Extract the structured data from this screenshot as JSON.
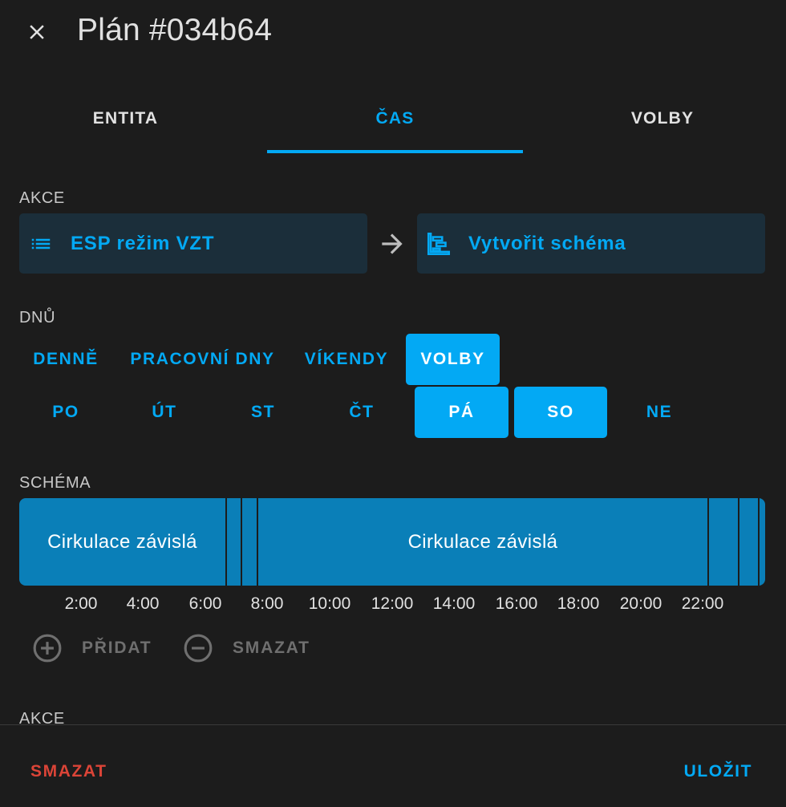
{
  "dialog": {
    "title": "Plán #034b64"
  },
  "tabs": [
    {
      "label": "ENTITA",
      "active": false
    },
    {
      "label": "ČAS",
      "active": true
    },
    {
      "label": "VOLBY",
      "active": false
    }
  ],
  "action_section": {
    "label": "AKCE",
    "entity_button": "ESP režim VZT",
    "schema_button": "Vytvořit schéma"
  },
  "days_section": {
    "label": "DNŮ",
    "presets": [
      {
        "label": "DENNĚ",
        "selected": false
      },
      {
        "label": "PRACOVNÍ DNY",
        "selected": false
      },
      {
        "label": "VÍKENDY",
        "selected": false
      },
      {
        "label": "VOLBY",
        "selected": true
      }
    ],
    "days": [
      {
        "label": "PO",
        "selected": false
      },
      {
        "label": "ÚT",
        "selected": false
      },
      {
        "label": "ST",
        "selected": false
      },
      {
        "label": "ČT",
        "selected": false
      },
      {
        "label": "PÁ",
        "selected": true
      },
      {
        "label": "SO",
        "selected": true
      },
      {
        "label": "NE",
        "selected": false
      }
    ]
  },
  "schema_section": {
    "label": "SCHÉMA",
    "segments": [
      {
        "label": "Cirkulace závislá"
      },
      {
        "label": "Cirkulace závislá"
      }
    ],
    "time_ticks": [
      "2:00",
      "4:00",
      "6:00",
      "8:00",
      "10:00",
      "12:00",
      "14:00",
      "16:00",
      "18:00",
      "20:00",
      "22:00"
    ],
    "add_label": "PŘIDAT",
    "remove_label": "SMAZAT"
  },
  "next_section": {
    "label": "AKCE"
  },
  "footer": {
    "delete_label": "SMAZAT",
    "save_label": "ULOŽIT"
  },
  "colors": {
    "accent": "#03a9f4",
    "danger": "#db4437",
    "background": "#1c1c1c",
    "segment": "#0a7fb8"
  }
}
